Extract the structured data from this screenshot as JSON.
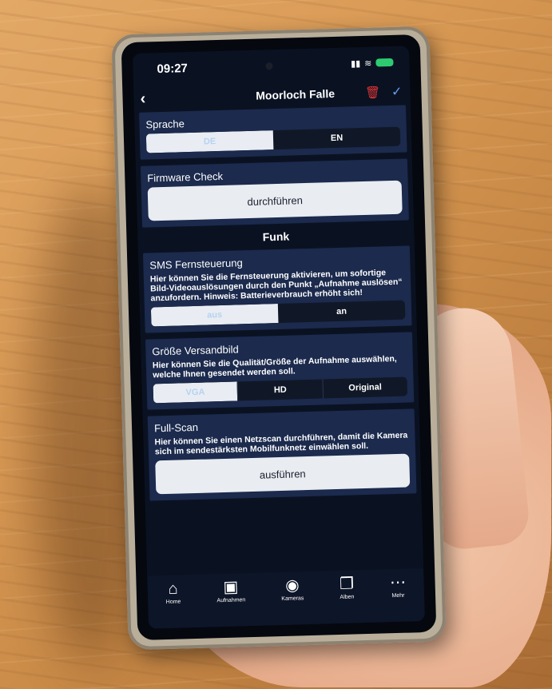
{
  "status": {
    "time": "09:27"
  },
  "nav": {
    "title": "Moorloch Falle"
  },
  "language": {
    "title": "Sprache",
    "options": [
      "DE",
      "EN"
    ],
    "selected": "DE"
  },
  "firmware": {
    "title": "Firmware Check",
    "button": "durchführen"
  },
  "section": {
    "heading": "Funk"
  },
  "sms": {
    "title": "SMS Fernsteuerung",
    "text": "Hier können Sie die Fernsteuerung aktivieren, um sofortige Bild-Videoauslösungen durch den Punkt „Aufnahme auslösen“ anzufordern. Hinweis: Batterieverbrauch erhöht sich!",
    "options": [
      "aus",
      "an"
    ],
    "selected": "aus"
  },
  "size": {
    "title": "Größe Versandbild",
    "text": "Hier können Sie die Qualität/Größe der Aufnahme auswählen, welche Ihnen gesendet werden soll.",
    "options": [
      "VGA",
      "HD",
      "Original"
    ],
    "selected": "VGA"
  },
  "fullscan": {
    "title": "Full-Scan",
    "text": "Hier können Sie einen Netzscan durchführen, damit die Kamera sich im sendestärksten Mobilfunknetz einwählen soll.",
    "button": "ausführen"
  },
  "tabs": [
    {
      "label": "Home",
      "icon": "home-icon"
    },
    {
      "label": "Aufnahmen",
      "icon": "image-icon"
    },
    {
      "label": "Kameras",
      "icon": "camera-icon"
    },
    {
      "label": "Alben",
      "icon": "albums-icon"
    },
    {
      "label": "Mehr",
      "icon": "more-icon"
    }
  ],
  "colors": {
    "card": "#1b2a4d",
    "screen": "#0a1222",
    "accent": "#6a9cf0",
    "delete": "#e03535"
  }
}
